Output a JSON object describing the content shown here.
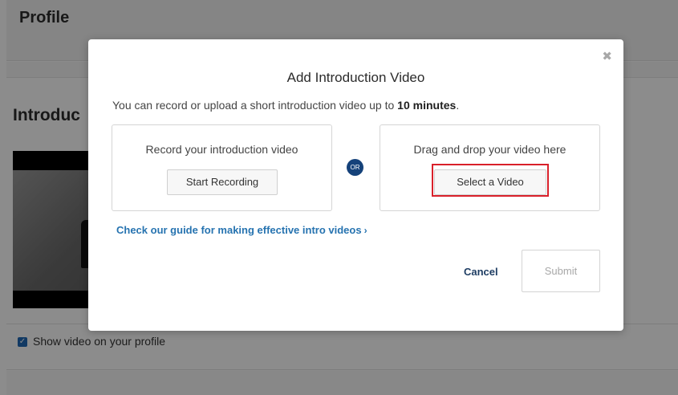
{
  "page": {
    "title": "Profile",
    "section_title": "Introduc",
    "show_video_label": "Show video on your profile"
  },
  "modal": {
    "title": "Add Introduction Video",
    "description_prefix": "You can record or upload a short introduction video up to ",
    "description_bold": "10 minutes",
    "description_suffix": ".",
    "close_icon": "✖",
    "record": {
      "text": "Record your introduction video",
      "button_label": "Start Recording"
    },
    "or_label": "OR",
    "upload": {
      "text": "Drag and drop your video here",
      "button_label": "Select a Video"
    },
    "guide_link": "Check our guide for making effective intro videos",
    "guide_chevron": "›",
    "cancel_label": "Cancel",
    "submit_label": "Submit"
  },
  "colors": {
    "overlay": "rgba(0,0,0,0.45)",
    "link": "#2673b0",
    "or_badge": "#15427a",
    "highlight": "#d9202a",
    "checkbox": "#1f68b5"
  },
  "icons": {
    "close": "close-icon",
    "checkbox": "checkbox-checked-icon",
    "chevron": "chevron-right-icon"
  }
}
